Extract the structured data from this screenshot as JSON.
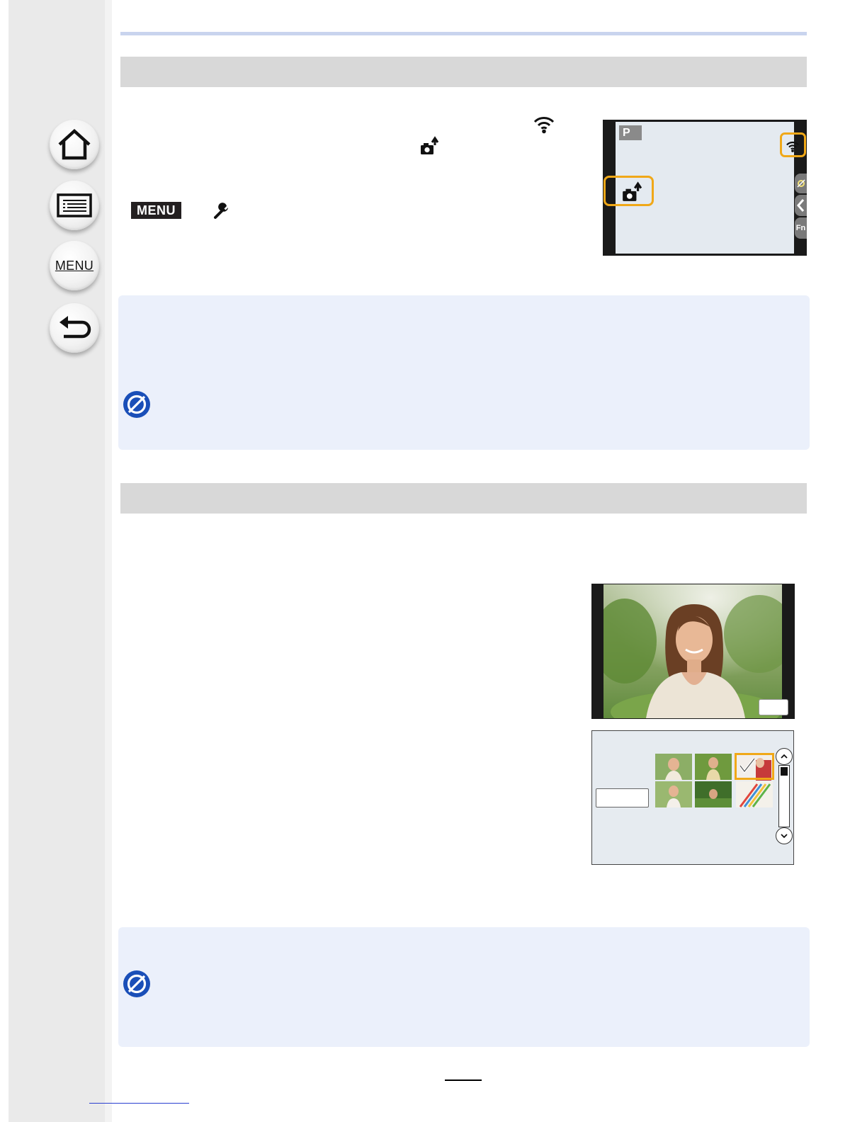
{
  "nav": {
    "home_icon": "home-icon",
    "contents_icon": "table-of-contents-icon",
    "menu_label": "MENU",
    "back_icon": "return-arrow-icon"
  },
  "section1": {
    "menu_badge": "MENU",
    "setup_icon": "wrench-icon",
    "wifi_icon": "wifi-icon",
    "upload_icon": "camera-upload-icon"
  },
  "screen1": {
    "mode": "P",
    "fn_label": "Fn"
  },
  "notes": {
    "icon": "not-available-icon"
  },
  "colors": {
    "highlight": "#f0a818",
    "note_icon": "#1a4fb8",
    "note_bg": "#ebf0fb",
    "section_bar": "#d8d8d8"
  }
}
